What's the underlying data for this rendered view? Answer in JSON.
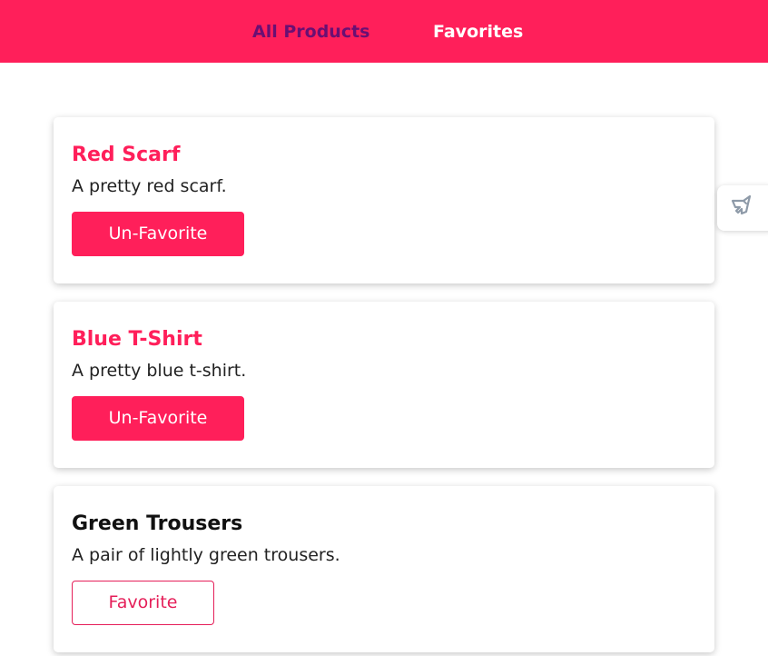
{
  "nav": {
    "all_products": "All Products",
    "favorites": "Favorites"
  },
  "products": [
    {
      "name": "Red Scarf",
      "description": "A pretty red scarf.",
      "button_label": "Un-Favorite",
      "favorited": true
    },
    {
      "name": "Blue T-Shirt",
      "description": "A pretty blue t-shirt.",
      "button_label": "Un-Favorite",
      "favorited": true
    },
    {
      "name": "Green Trousers",
      "description": "A pair of lightly green trousers.",
      "button_label": "Favorite",
      "favorited": false
    }
  ],
  "side_tab": {
    "icon": "rocket-icon"
  },
  "colors": {
    "brand": "#ff1f5a",
    "nav_inactive": "#6a0f73",
    "nav_active": "#ffffff"
  }
}
